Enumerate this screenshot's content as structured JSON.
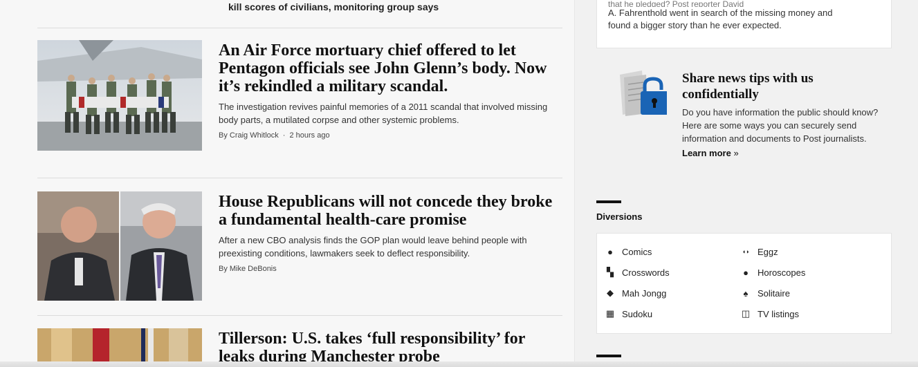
{
  "top_headline": "kill scores of civilians, monitoring group says",
  "stories": [
    {
      "title": "An Air Force mortuary chief offered to let Pentagon officials see John Glenn’s body. Now it’s rekindled a military scandal.",
      "blurb": "The investigation revives painful memories of a 2011 scandal that involved missing body parts, a mutilated corpse and other systemic problems.",
      "byline": "By Craig Whitlock",
      "dot": "·",
      "time": "2 hours ago"
    },
    {
      "title": "House Republicans will not concede they broke a fundamental health-care promise",
      "blurb": "After a new CBO analysis finds the GOP plan would leave behind people with preexisting conditions, lawmakers seek to deflect responsibility.",
      "byline": "By Mike DeBonis"
    },
    {
      "title": "Tillerson: U.S. takes ‘full responsibility’ for leaks during Manchester probe"
    }
  ],
  "right_rail": {
    "top_card": {
      "faint_line": "that he pledged? Post reporter David",
      "line1": "A. Fahrenthold went in search of the missing money and",
      "line2": "found a bigger story than he ever expected."
    },
    "tips": {
      "title": "Share news tips with us confidentially",
      "text": "Do you have information the public should know? Here are some ways you can securely send information and documents to Post journalists.",
      "link": "Learn more",
      "link_chevron": "»"
    },
    "diversions": {
      "label": "Diversions",
      "items": [
        {
          "label": "Comics",
          "icon": "comics-icon",
          "glyph": "●"
        },
        {
          "label": "Eggz",
          "icon": "eggz-icon",
          "glyph": "◖◗"
        },
        {
          "label": "Crosswords",
          "icon": "crosswords-icon",
          "glyph": "▚"
        },
        {
          "label": "Horoscopes",
          "icon": "horoscopes-icon",
          "glyph": "●"
        },
        {
          "label": "Mah Jongg",
          "icon": "mahjongg-icon",
          "glyph": "◆"
        },
        {
          "label": "Solitaire",
          "icon": "spade-icon",
          "glyph": "♠"
        },
        {
          "label": "Sudoku",
          "icon": "sudoku-icon",
          "glyph": "▦"
        },
        {
          "label": "TV listings",
          "icon": "tv-icon",
          "glyph": "◫"
        }
      ]
    }
  },
  "colors": {
    "lock_blue": "#1a64b5",
    "headline": "#111111",
    "page_bg": "#f7f7f7"
  }
}
